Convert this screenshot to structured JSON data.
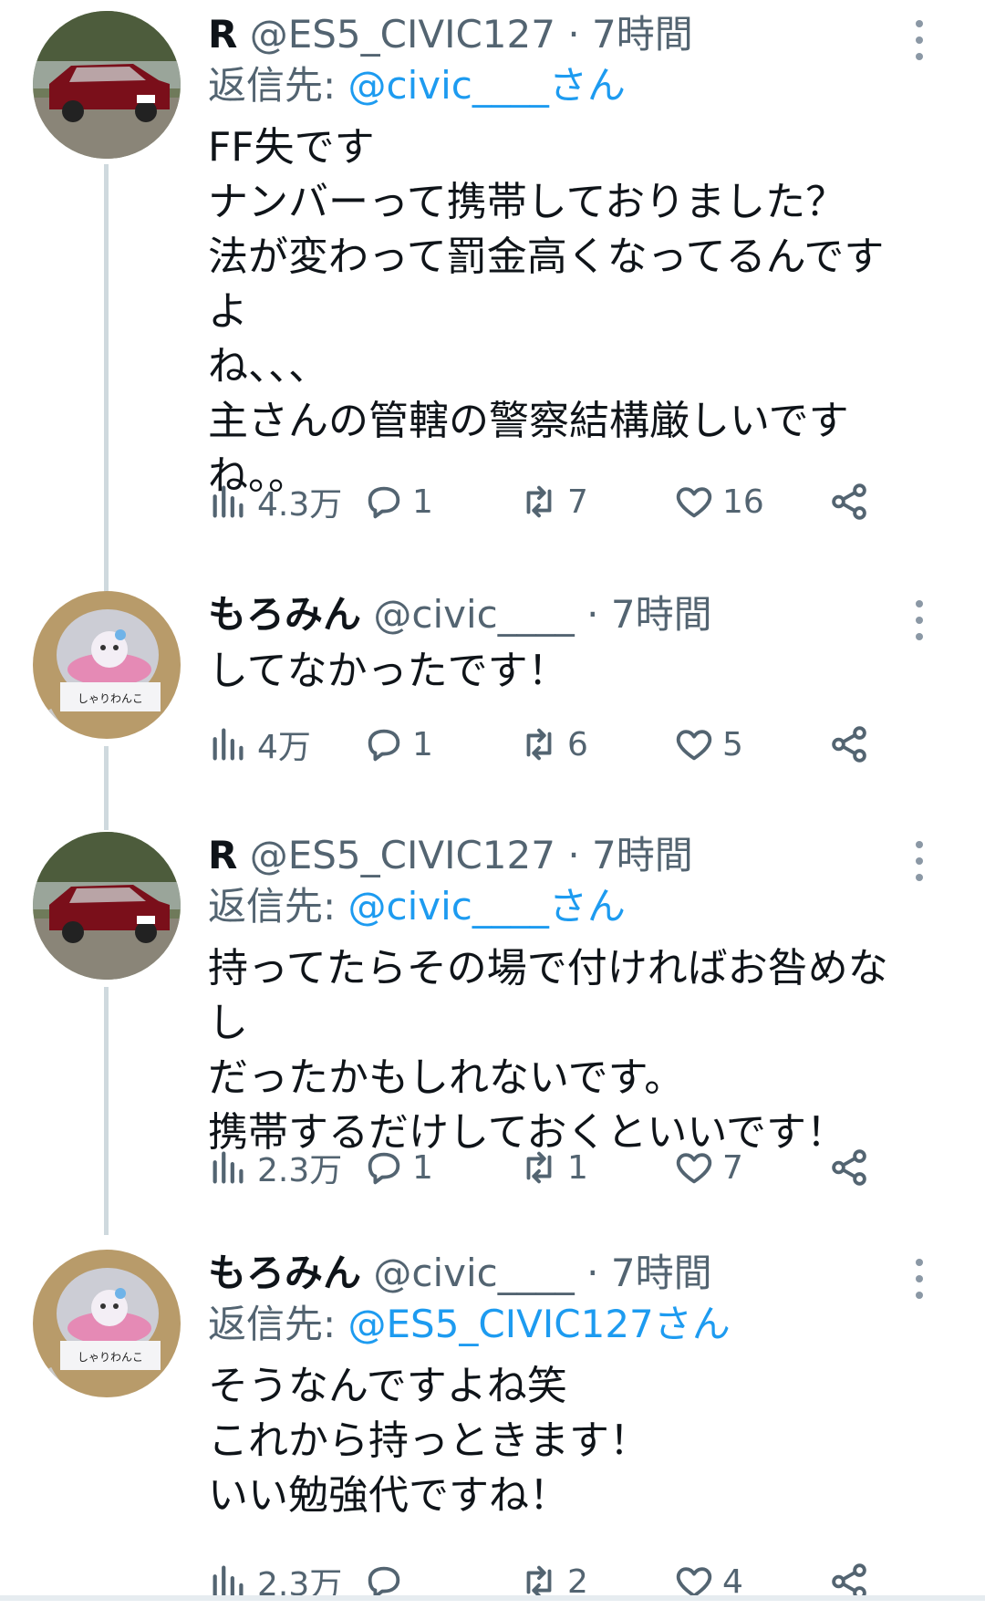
{
  "tweets": [
    {
      "name": "R",
      "handle": "@ES5_CIVIC127",
      "dot": "·",
      "time": "7時間",
      "reply_prefix": "返信先: ",
      "reply_to": "@civic____さん",
      "text": "FF失です\nナンバーって携帯しておりました？\n法が変わって罰金高くなってるんですよ\nね、、、\n主さんの管轄の警察結構厳しいです\nね。。",
      "views": "4.3万",
      "replies": "1",
      "retweets": "7",
      "likes": "16",
      "avatar_icon": "red-sedan-photo"
    },
    {
      "name": "もろみん",
      "handle": "@civic____",
      "dot": "·",
      "time": "7時間",
      "text": "してなかったです！",
      "views": "4万",
      "replies": "1",
      "retweets": "6",
      "likes": "5",
      "avatar_icon": "plush-keychain-photo",
      "avatar_label": "しゃりわんこ"
    },
    {
      "name": "R",
      "handle": "@ES5_CIVIC127",
      "dot": "·",
      "time": "7時間",
      "reply_prefix": "返信先: ",
      "reply_to": "@civic____さん",
      "text": "持ってたらその場で付ければお咎めなし\nだったかもしれないです。\n携帯するだけしておくといいです！",
      "views": "2.3万",
      "replies": "1",
      "retweets": "1",
      "likes": "7",
      "avatar_icon": "red-sedan-photo"
    },
    {
      "name": "もろみん",
      "handle": "@civic____",
      "dot": "·",
      "time": "7時間",
      "reply_prefix": "返信先: ",
      "reply_to": "@ES5_CIVIC127さん",
      "text": "そうなんですよね笑\nこれから持っときます！\nいい勉強代ですね！",
      "views": "2.3万",
      "replies": "",
      "retweets": "2",
      "likes": "4",
      "avatar_icon": "plush-keychain-photo",
      "avatar_label": "しゃりわんこ"
    }
  ],
  "colors": {
    "text": "#0f1419",
    "secondary": "#536471",
    "link": "#1d9bf0",
    "thread_line": "#cfd9de"
  }
}
